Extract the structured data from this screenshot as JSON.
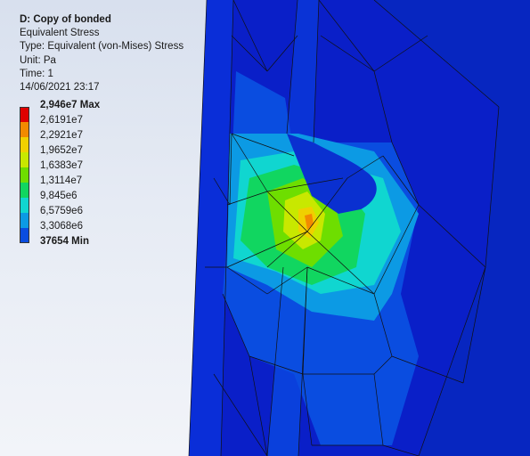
{
  "info": {
    "title": "D: Copy of bonded",
    "result": "Equivalent Stress",
    "type": "Type: Equivalent (von-Mises) Stress",
    "unit": "Unit: Pa",
    "time": "Time: 1",
    "timestamp": "14/06/2021 23:17"
  },
  "legend": {
    "labels": [
      "2,946e7 Max",
      "2,6191e7",
      "2,2921e7",
      "1,9652e7",
      "1,6383e7",
      "1,3114e7",
      "9,845e6",
      "6,5759e6",
      "3,3068e6",
      "37654 Min"
    ],
    "colors": [
      "#e00000",
      "#f28a00",
      "#f0d000",
      "#c8e800",
      "#6ede00",
      "#11d660",
      "#10d6d0",
      "#0c9ae4",
      "#0a4de0",
      "#0018cc"
    ]
  },
  "colors": {
    "background_top": "#d8e0ee",
    "background_bottom": "#f2f4f9",
    "mesh_line": "#101010"
  }
}
